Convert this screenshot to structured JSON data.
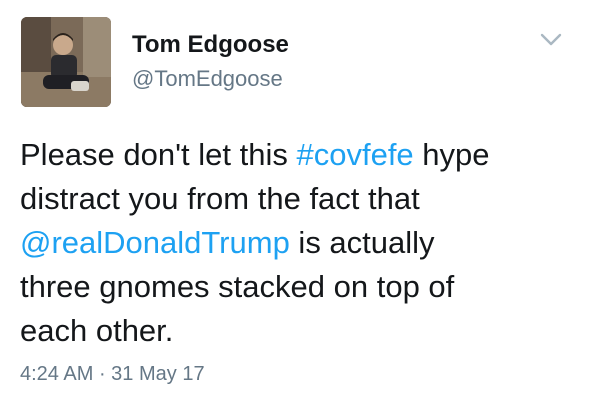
{
  "author": {
    "display_name": "Tom Edgoose",
    "handle": "@TomEdgoose",
    "avatar_icon": "profile-photo"
  },
  "menu": {
    "icon": "chevron-down-icon"
  },
  "tweet": {
    "line1_pre": "Please don't let this ",
    "hashtag": "#covfefe",
    "line1_post": " hype",
    "line2": "distract you from the fact that",
    "mention": "@realDonaldTrump",
    "line3_post": " is actually",
    "line4": "three gnomes stacked on top of",
    "line5": "each other."
  },
  "meta": {
    "time": "4:24 AM",
    "separator": " · ",
    "date": "31 May 17"
  },
  "colors": {
    "link": "#1da1f2",
    "secondary_text": "#657786",
    "primary_text": "#14171a"
  }
}
